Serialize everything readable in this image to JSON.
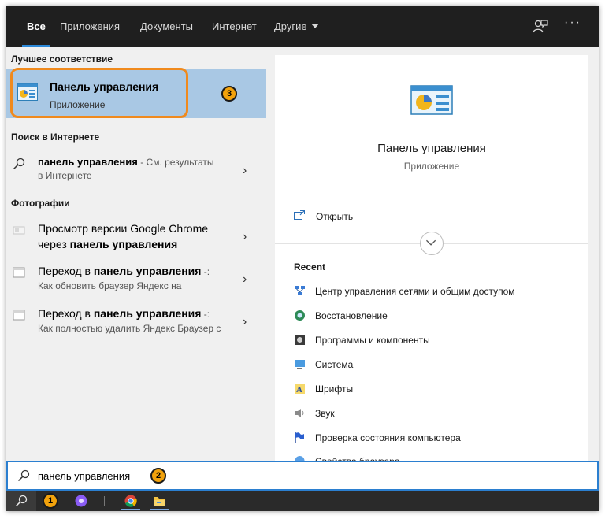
{
  "tabs": [
    {
      "label": "Все"
    },
    {
      "label": "Приложения"
    },
    {
      "label": "Документы"
    },
    {
      "label": "Интернет"
    },
    {
      "label": "Другие"
    }
  ],
  "icons": {
    "feedback": "feedback-icon",
    "more": "more-icon",
    "control_panel": "control-panel-icon",
    "search": "search-icon"
  },
  "left": {
    "best_match_heading": "Лучшее соответствие",
    "best_match": {
      "title": "Панель управления",
      "subtitle": "Приложение"
    },
    "web_heading": "Поиск в Интернете",
    "web_result": {
      "query": "панель управления",
      "suffix": " - См. результаты",
      "line2": "в Интернете"
    },
    "photos_heading": "Фотографии",
    "photos": [
      {
        "line1_pre": "Просмотр версии Google Chrome",
        "line2_pre": "через ",
        "line2_bold": "панель управления"
      },
      {
        "line1_pre": "Переход в ",
        "line1_bold": "панель управления",
        "line1_post": " -:",
        "line2": "Как обновить браузер Яндекс на"
      },
      {
        "line1_pre": "Переход в ",
        "line1_bold": "панель управления",
        "line1_post": " -:",
        "line2": "Как полностью удалить Яндекс Браузер с"
      }
    ]
  },
  "right": {
    "app_title": "Панель управления",
    "app_subtitle": "Приложение",
    "open_label": "Открыть",
    "recent_heading": "Recent",
    "recent": [
      {
        "label": "Центр управления сетями и общим доступом",
        "icon": "network-center-icon"
      },
      {
        "label": "Восстановление",
        "icon": "recovery-icon"
      },
      {
        "label": "Программы и компоненты",
        "icon": "programs-icon"
      },
      {
        "label": "Система",
        "icon": "system-icon"
      },
      {
        "label": "Шрифты",
        "icon": "fonts-icon"
      },
      {
        "label": "Звук",
        "icon": "sound-icon"
      },
      {
        "label": "Проверка состояния компьютера",
        "icon": "flag-icon"
      },
      {
        "label": "Свойства браузера",
        "icon": "internet-options-icon"
      }
    ]
  },
  "search": {
    "value": "панель управления"
  },
  "badges": {
    "one": "1",
    "two": "2",
    "three": "3"
  },
  "colors": {
    "accent": "#2b88d8",
    "selection": "#a9c8e4",
    "annotation": "#f08a1d",
    "badge": "#f2a20c"
  }
}
